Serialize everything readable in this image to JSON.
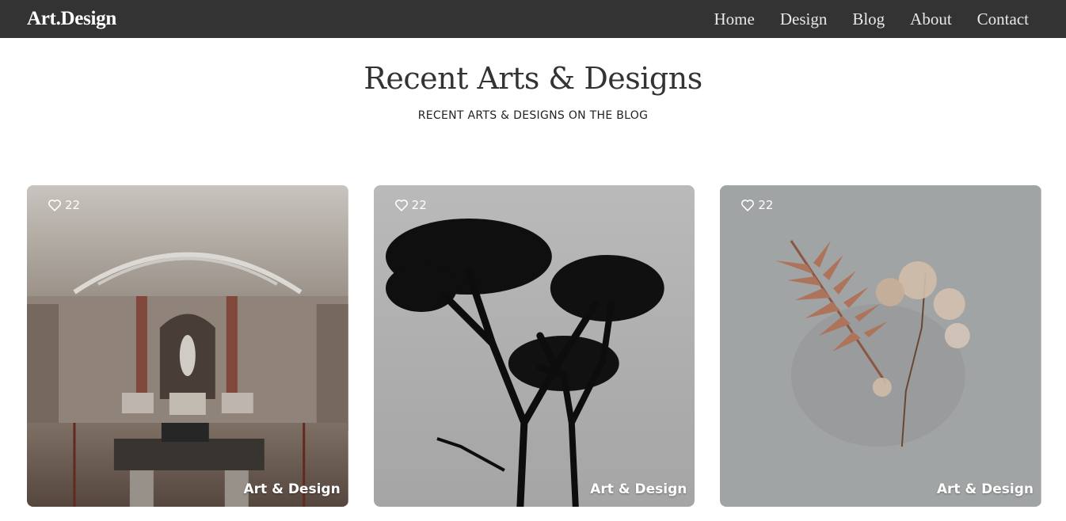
{
  "header": {
    "brand": "Art.Design",
    "nav": [
      "Home",
      "Design",
      "Blog",
      "About",
      "Contact"
    ]
  },
  "hero": {
    "title": "Recent Arts & Designs",
    "subtitle": "RECENT ARTS & DESIGNS ON THE BLOG"
  },
  "cards": [
    {
      "likes": "22",
      "category": "Art & Design",
      "image": "museum-gallery-photo",
      "icon": "heart-icon"
    },
    {
      "likes": "22",
      "category": "Art & Design",
      "image": "tree-silhouette-photo",
      "icon": "heart-icon"
    },
    {
      "likes": "22",
      "category": "Art & Design",
      "image": "dried-fern-flower-photo",
      "icon": "heart-icon"
    }
  ],
  "colors": {
    "header_bg": "#333333",
    "page_bg": "#ffffff",
    "text": "#333333"
  }
}
